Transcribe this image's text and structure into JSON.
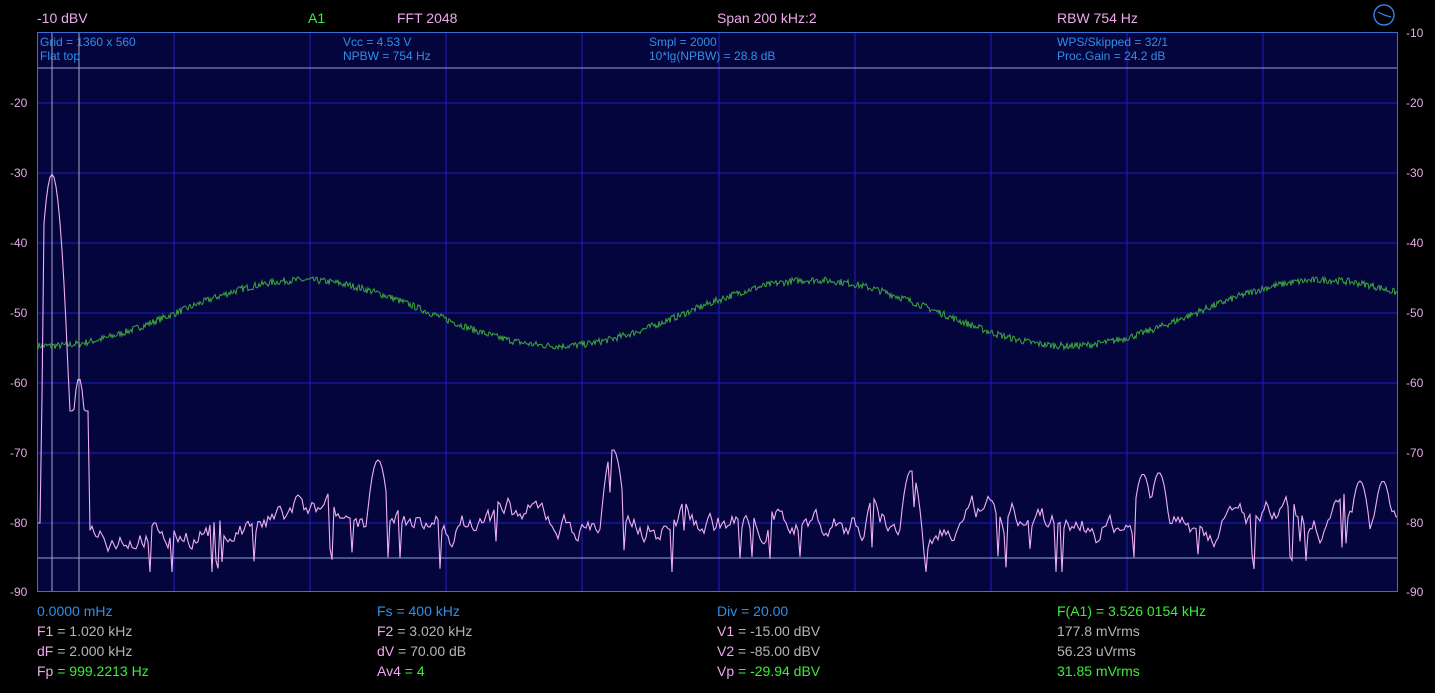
{
  "header": {
    "ref_level": "-10 dBV",
    "channel": "A1",
    "fft": "FFT  2048",
    "span": "Span 200 kHz:2",
    "rbw": "RBW 754 Hz",
    "clock_icon": "clock-icon"
  },
  "info": {
    "col1": [
      "Grid = 1360 x 560",
      "Flat top"
    ],
    "col2": [
      "Vcc = 4.53 V",
      "NPBW = 754 Hz"
    ],
    "col3": [
      "Smpl = 2000",
      "10*lg(NPBW) = 28.8 dB"
    ],
    "col4": [
      "WPS/Skipped  = 32/1",
      "Proc.Gain = 24.2 dB"
    ]
  },
  "axis": {
    "left_ticks": [
      "-20",
      "-30",
      "-40",
      "-50",
      "-60",
      "-70",
      "-80",
      "-90"
    ],
    "right_ticks": [
      "-10",
      "-20",
      "-30",
      "-40",
      "-50",
      "-60",
      "-70",
      "-80",
      "-90"
    ]
  },
  "colors": {
    "plot_bg": "#05053e",
    "grid": "#1d1dc0",
    "spectrum": "#f0b0f0",
    "waveform": "#3aa63a",
    "cursor": "#a8a8c8"
  },
  "readouts": {
    "col1": {
      "r0": "0.0000 mHz",
      "r1_label": "F1",
      "r1_val": " = 1.020 kHz",
      "r2_label": "dF",
      "r2_val": " = 2.000 kHz",
      "r3_label": "Fp",
      "r3_val": " = 999.2213 Hz"
    },
    "col2": {
      "r0": "Fs = 400 kHz",
      "r1_label": "F2",
      "r1_val": " = 3.020 kHz",
      "r2_label": "dV",
      "r2_val": " = 70.00 dB",
      "r3_label": "Av4",
      "r3_val": " = 4"
    },
    "col3": {
      "r0": "Div = 20.00",
      "r1_label": "V1",
      "r1_val": " = -15.00 dBV",
      "r2_label": "V2",
      "r2_val": " = -85.00 dBV",
      "r3_label": "Vp",
      "r3_val": " = -29.94 dBV"
    },
    "col4": {
      "r0": "F(A1) = 3.526 0154 kHz",
      "r1": "177.8 mVrms",
      "r2": "56.23 uVrms",
      "r3": "31.85 mVrms"
    }
  }
}
